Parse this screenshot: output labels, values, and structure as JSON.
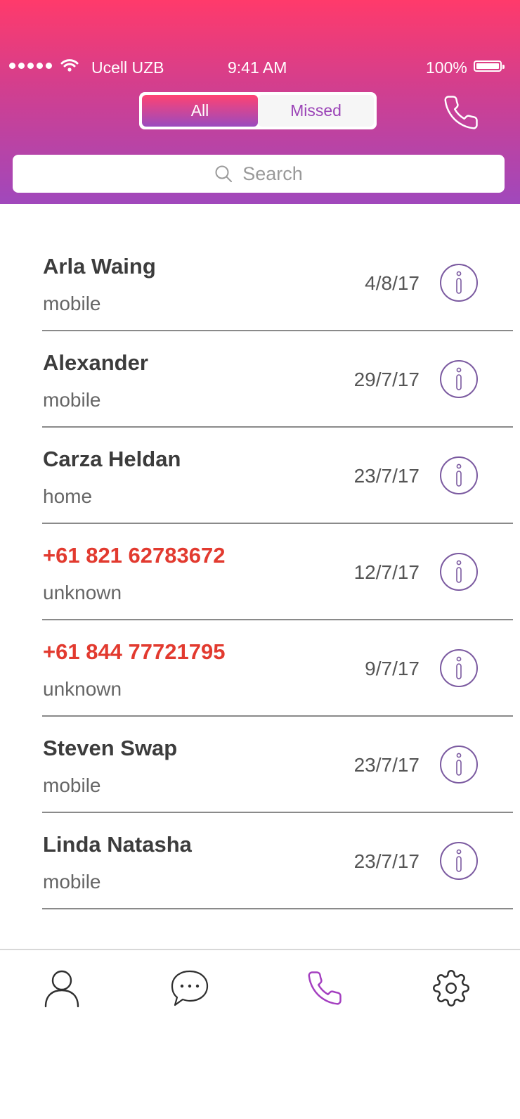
{
  "status_bar": {
    "carrier": "Ucell UZB",
    "time": "9:41 AM",
    "battery": "100%",
    "signal_icon": "signal-dots-icon",
    "wifi_icon": "wifi-icon",
    "battery_icon": "battery-icon"
  },
  "header": {
    "segments": [
      "All",
      "Missed"
    ],
    "selected_segment": "All",
    "call_icon": "phone-icon"
  },
  "search": {
    "placeholder": "Search",
    "icon": "search-icon"
  },
  "calls": [
    {
      "name": "Arla Waing",
      "type": "mobile",
      "date": "4/8/17",
      "unknown": false
    },
    {
      "name": "Alexander",
      "type": "mobile",
      "date": "29/7/17",
      "unknown": false
    },
    {
      "name": "Carza Heldan",
      "type": "home",
      "date": "23/7/17",
      "unknown": false
    },
    {
      "name": "+61 821 62783672",
      "type": "unknown",
      "date": "12/7/17",
      "unknown": true
    },
    {
      "name": "+61 844 77721795",
      "type": "unknown",
      "date": "9/7/17",
      "unknown": true
    },
    {
      "name": "Steven Swap",
      "type": "mobile",
      "date": "23/7/17",
      "unknown": false
    },
    {
      "name": "Linda Natasha",
      "type": "mobile",
      "date": "23/7/17",
      "unknown": false
    }
  ],
  "tab_bar": {
    "tabs": [
      {
        "icon": "contacts-icon",
        "active": false
      },
      {
        "icon": "chat-icon",
        "active": false
      },
      {
        "icon": "phone-icon",
        "active": true
      },
      {
        "icon": "gear-icon",
        "active": false
      }
    ]
  },
  "colors": {
    "gradient_top": "#ff3a6b",
    "gradient_bottom": "#a048bc",
    "accent_purple": "#9b44b7",
    "unknown_red": "#e23a2f"
  }
}
